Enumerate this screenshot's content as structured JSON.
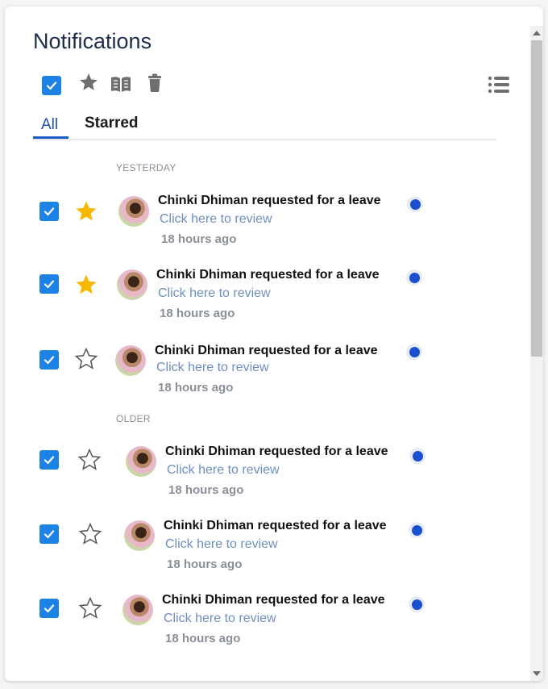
{
  "header": {
    "title": "Notifications"
  },
  "tabs": [
    {
      "label": "All",
      "active": true
    },
    {
      "label": "Starred",
      "active": false
    }
  ],
  "sections": {
    "yesterday": "YESTERDAY",
    "older": "OLDER"
  },
  "colors": {
    "accent": "#1d82e5",
    "star_filled": "#f6b800",
    "unread_dot": "#1a4fcf",
    "link": "#6e8fc0"
  },
  "notifications": [
    {
      "message": "Chinki Dhiman requested for a leave",
      "link": "Click here to review",
      "time": "18 hours ago",
      "starred": true,
      "checked": true,
      "unread": true
    },
    {
      "message": "Chinki Dhiman requested for a leave",
      "link": "Click here to review",
      "time": "18 hours ago",
      "starred": true,
      "checked": true,
      "unread": true
    },
    {
      "message": "Chinki Dhiman requested for a leave",
      "link": "Click here to review",
      "time": "18 hours ago",
      "starred": false,
      "checked": true,
      "unread": true
    },
    {
      "message": "Chinki Dhiman requested for a leave",
      "link": "Click here to review",
      "time": "18 hours ago",
      "starred": false,
      "checked": true,
      "unread": true
    },
    {
      "message": "Chinki Dhiman requested for a leave",
      "link": "Click here to review",
      "time": "18 hours ago",
      "starred": false,
      "checked": true,
      "unread": true
    },
    {
      "message": "Chinki Dhiman requested for a leave",
      "link": "Click here to review",
      "time": "18 hours ago",
      "starred": false,
      "checked": true,
      "unread": true
    }
  ],
  "icons": [
    "check-icon",
    "star-icon",
    "book-open-icon",
    "trash-icon",
    "list-icon"
  ]
}
